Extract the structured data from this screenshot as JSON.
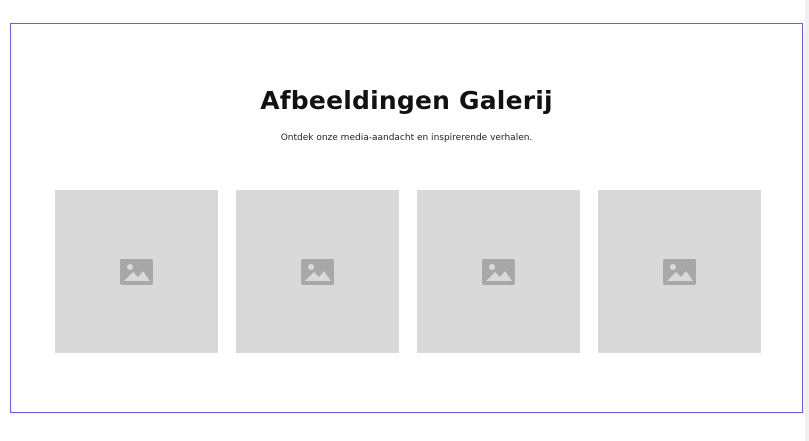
{
  "gallery": {
    "title": "Afbeeldingen Galerij",
    "subtitle": "Ontdek onze media-aandacht en inspirerende verhalen.",
    "images": [
      {
        "icon": "image-placeholder-icon"
      },
      {
        "icon": "image-placeholder-icon"
      },
      {
        "icon": "image-placeholder-icon"
      },
      {
        "icon": "image-placeholder-icon"
      }
    ]
  },
  "colors": {
    "background": "#f1f0f0",
    "border": "#6a5cf0",
    "placeholder": "#d9d9d9",
    "icon": "#a8a8a8"
  }
}
